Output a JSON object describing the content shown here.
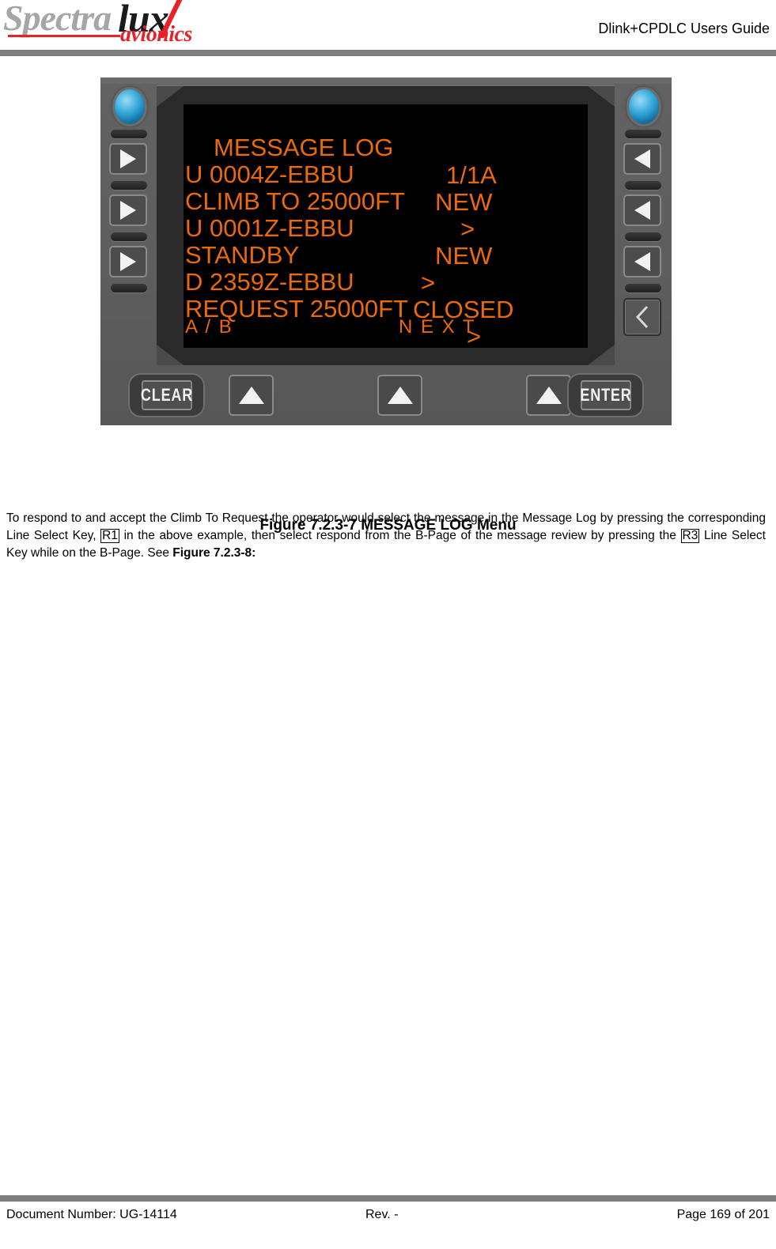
{
  "header": {
    "logo": {
      "part1": "Spectra",
      "part2": "lux",
      "tagline": "avionics"
    },
    "title": "Dlink+CPDLC Users Guide"
  },
  "figure": {
    "caption": "Figure 7.2.3-7 MESSAGE LOG Menu",
    "device": {
      "screen": {
        "title": "MESSAGE LOG",
        "page_indicator": "1/1A",
        "rows": [
          {
            "label": "U 0004Z-EBBU",
            "value": "NEW"
          },
          {
            "label": "CLIMB TO 25000FT",
            "value": ">"
          },
          {
            "label": "U 0001Z-EBBU",
            "value": "NEW"
          },
          {
            "label": "STANDBY",
            "value": ">"
          },
          {
            "label": "D 2359Z-EBBU",
            "value": "CLOSED"
          },
          {
            "label": "REQUEST 25000FT",
            "value": ">"
          }
        ],
        "footer_left": "A / B",
        "footer_right": "N E X T",
        "text_color": "#ea6a09",
        "background_color": "#000000"
      },
      "buttons": {
        "clear": "CLEAR",
        "enter": "ENTER",
        "left_keys": [
          "lsk-l1",
          "lsk-l2",
          "lsk-l3"
        ],
        "right_keys": [
          "lsk-r1",
          "lsk-r2",
          "lsk-r3"
        ],
        "back_chevron": "back-chevron"
      },
      "body_color": "#5e5e5e"
    }
  },
  "body": {
    "paragraph_1": "To respond to and accept the Climb To Request the operator would select the message in the Message Log by pressing the corresponding Line Select Key, ",
    "key_ref_1": "R1",
    "paragraph_2": " in the above example, then select respond from the B-Page of the message review by pressing the ",
    "key_ref_2": "R3",
    "paragraph_3": " Line Select Key while on the B-Page.  See ",
    "figure_ref": "Figure 7.2.3-8:"
  },
  "footer": {
    "document_number": "Document Number:  UG-14114",
    "revision": "Rev. -",
    "page": "Page 169 of 201"
  }
}
